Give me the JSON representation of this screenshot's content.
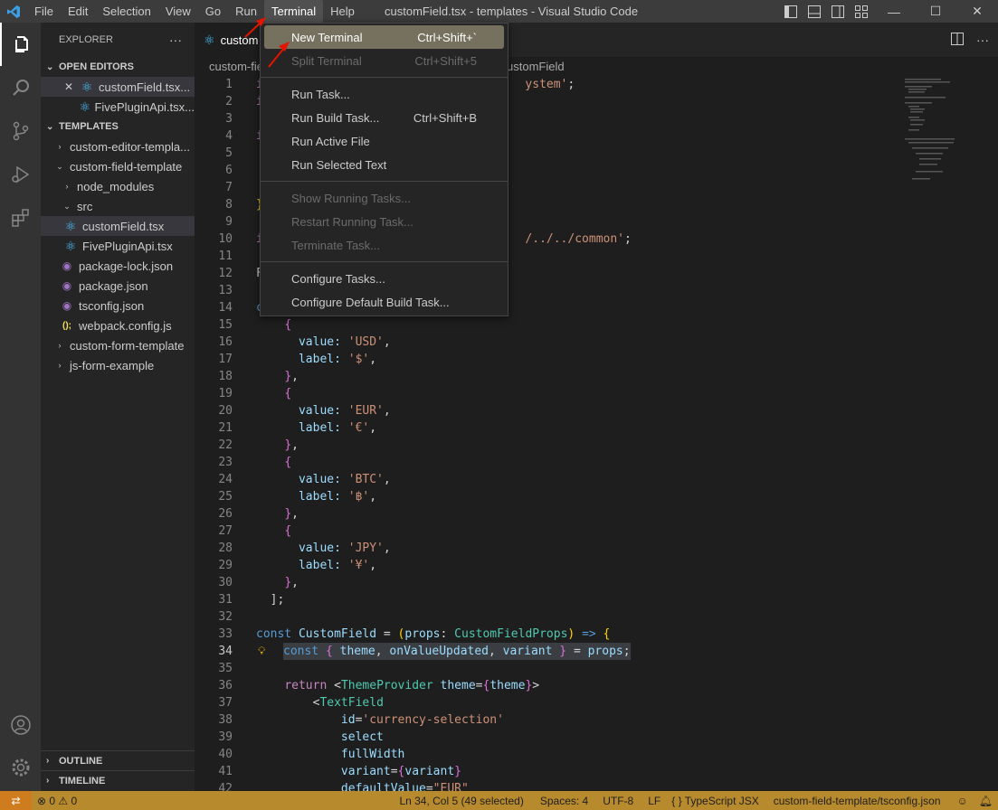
{
  "menubar": {
    "items": [
      "File",
      "Edit",
      "Selection",
      "View",
      "Go",
      "Run",
      "Terminal",
      "Help"
    ],
    "active": "Terminal"
  },
  "window_title": "customField.tsx - templates - Visual Studio Code",
  "window_controls": {
    "minimize": "—",
    "maximize": "☐",
    "close": "✕"
  },
  "sidebar": {
    "title": "EXPLORER",
    "more": "···",
    "open_editors_label": "OPEN EDITORS",
    "open_editors": [
      {
        "name": "customField.tsx...",
        "close": "✕"
      },
      {
        "name": "FivePluginApi.tsx..."
      }
    ],
    "workspace_label": "TEMPLATES",
    "tree": [
      {
        "label": "custom-editor-templa..."
      },
      {
        "label": "custom-field-template"
      },
      {
        "label": "node_modules"
      },
      {
        "label": "src"
      },
      {
        "label": "customField.tsx"
      },
      {
        "label": "FivePluginApi.tsx"
      },
      {
        "label": "package-lock.json"
      },
      {
        "label": "package.json"
      },
      {
        "label": "tsconfig.json"
      },
      {
        "label": "webpack.config.js"
      },
      {
        "label": "custom-form-template"
      },
      {
        "label": "js-form-example"
      }
    ],
    "outline_label": "OUTLINE",
    "timeline_label": "TIMELINE"
  },
  "editor": {
    "tab_label": "custom",
    "breadcrumb_left": "custom-fie",
    "breadcrumb_right": "ustomField",
    "line_numbers": [
      "1",
      "2",
      "3",
      "4",
      "5",
      "6",
      "7",
      "8",
      "9",
      "10",
      "11",
      "12",
      "13",
      "14",
      "15",
      "16",
      "17",
      "18",
      "19",
      "20",
      "21",
      "22",
      "23",
      "24",
      "25",
      "26",
      "27",
      "28",
      "29",
      "30",
      "31",
      "32",
      "33",
      "34",
      "35",
      "36",
      "37",
      "38",
      "39",
      "40",
      "41",
      "42"
    ],
    "current_line": "34"
  },
  "terminal_menu": {
    "items": [
      {
        "label": "New Terminal",
        "shortcut": "Ctrl+Shift+`"
      },
      {
        "label": "Split Terminal",
        "shortcut": "Ctrl+Shift+5"
      },
      {
        "label": "Run Task..."
      },
      {
        "label": "Run Build Task...",
        "shortcut": "Ctrl+Shift+B"
      },
      {
        "label": "Run Active File"
      },
      {
        "label": "Run Selected Text"
      },
      {
        "label": "Show Running Tasks..."
      },
      {
        "label": "Restart Running Task..."
      },
      {
        "label": "Terminate Task..."
      },
      {
        "label": "Configure Tasks..."
      },
      {
        "label": "Configure Default Build Task..."
      }
    ]
  },
  "statusbar": {
    "remote": "⇄",
    "problems": "⊗ 0 ⚠ 0",
    "cursor": "Ln 34, Col 5 (49 selected)",
    "spaces": "Spaces: 4",
    "encoding": "UTF-8",
    "eol": "LF",
    "language": "{ } TypeScript JSX",
    "tsconfig": "custom-field-template/tsconfig.json"
  },
  "colors": {
    "accent": "#b88a2e",
    "arrow": "#e51400",
    "menu_hover": "#75715e"
  }
}
